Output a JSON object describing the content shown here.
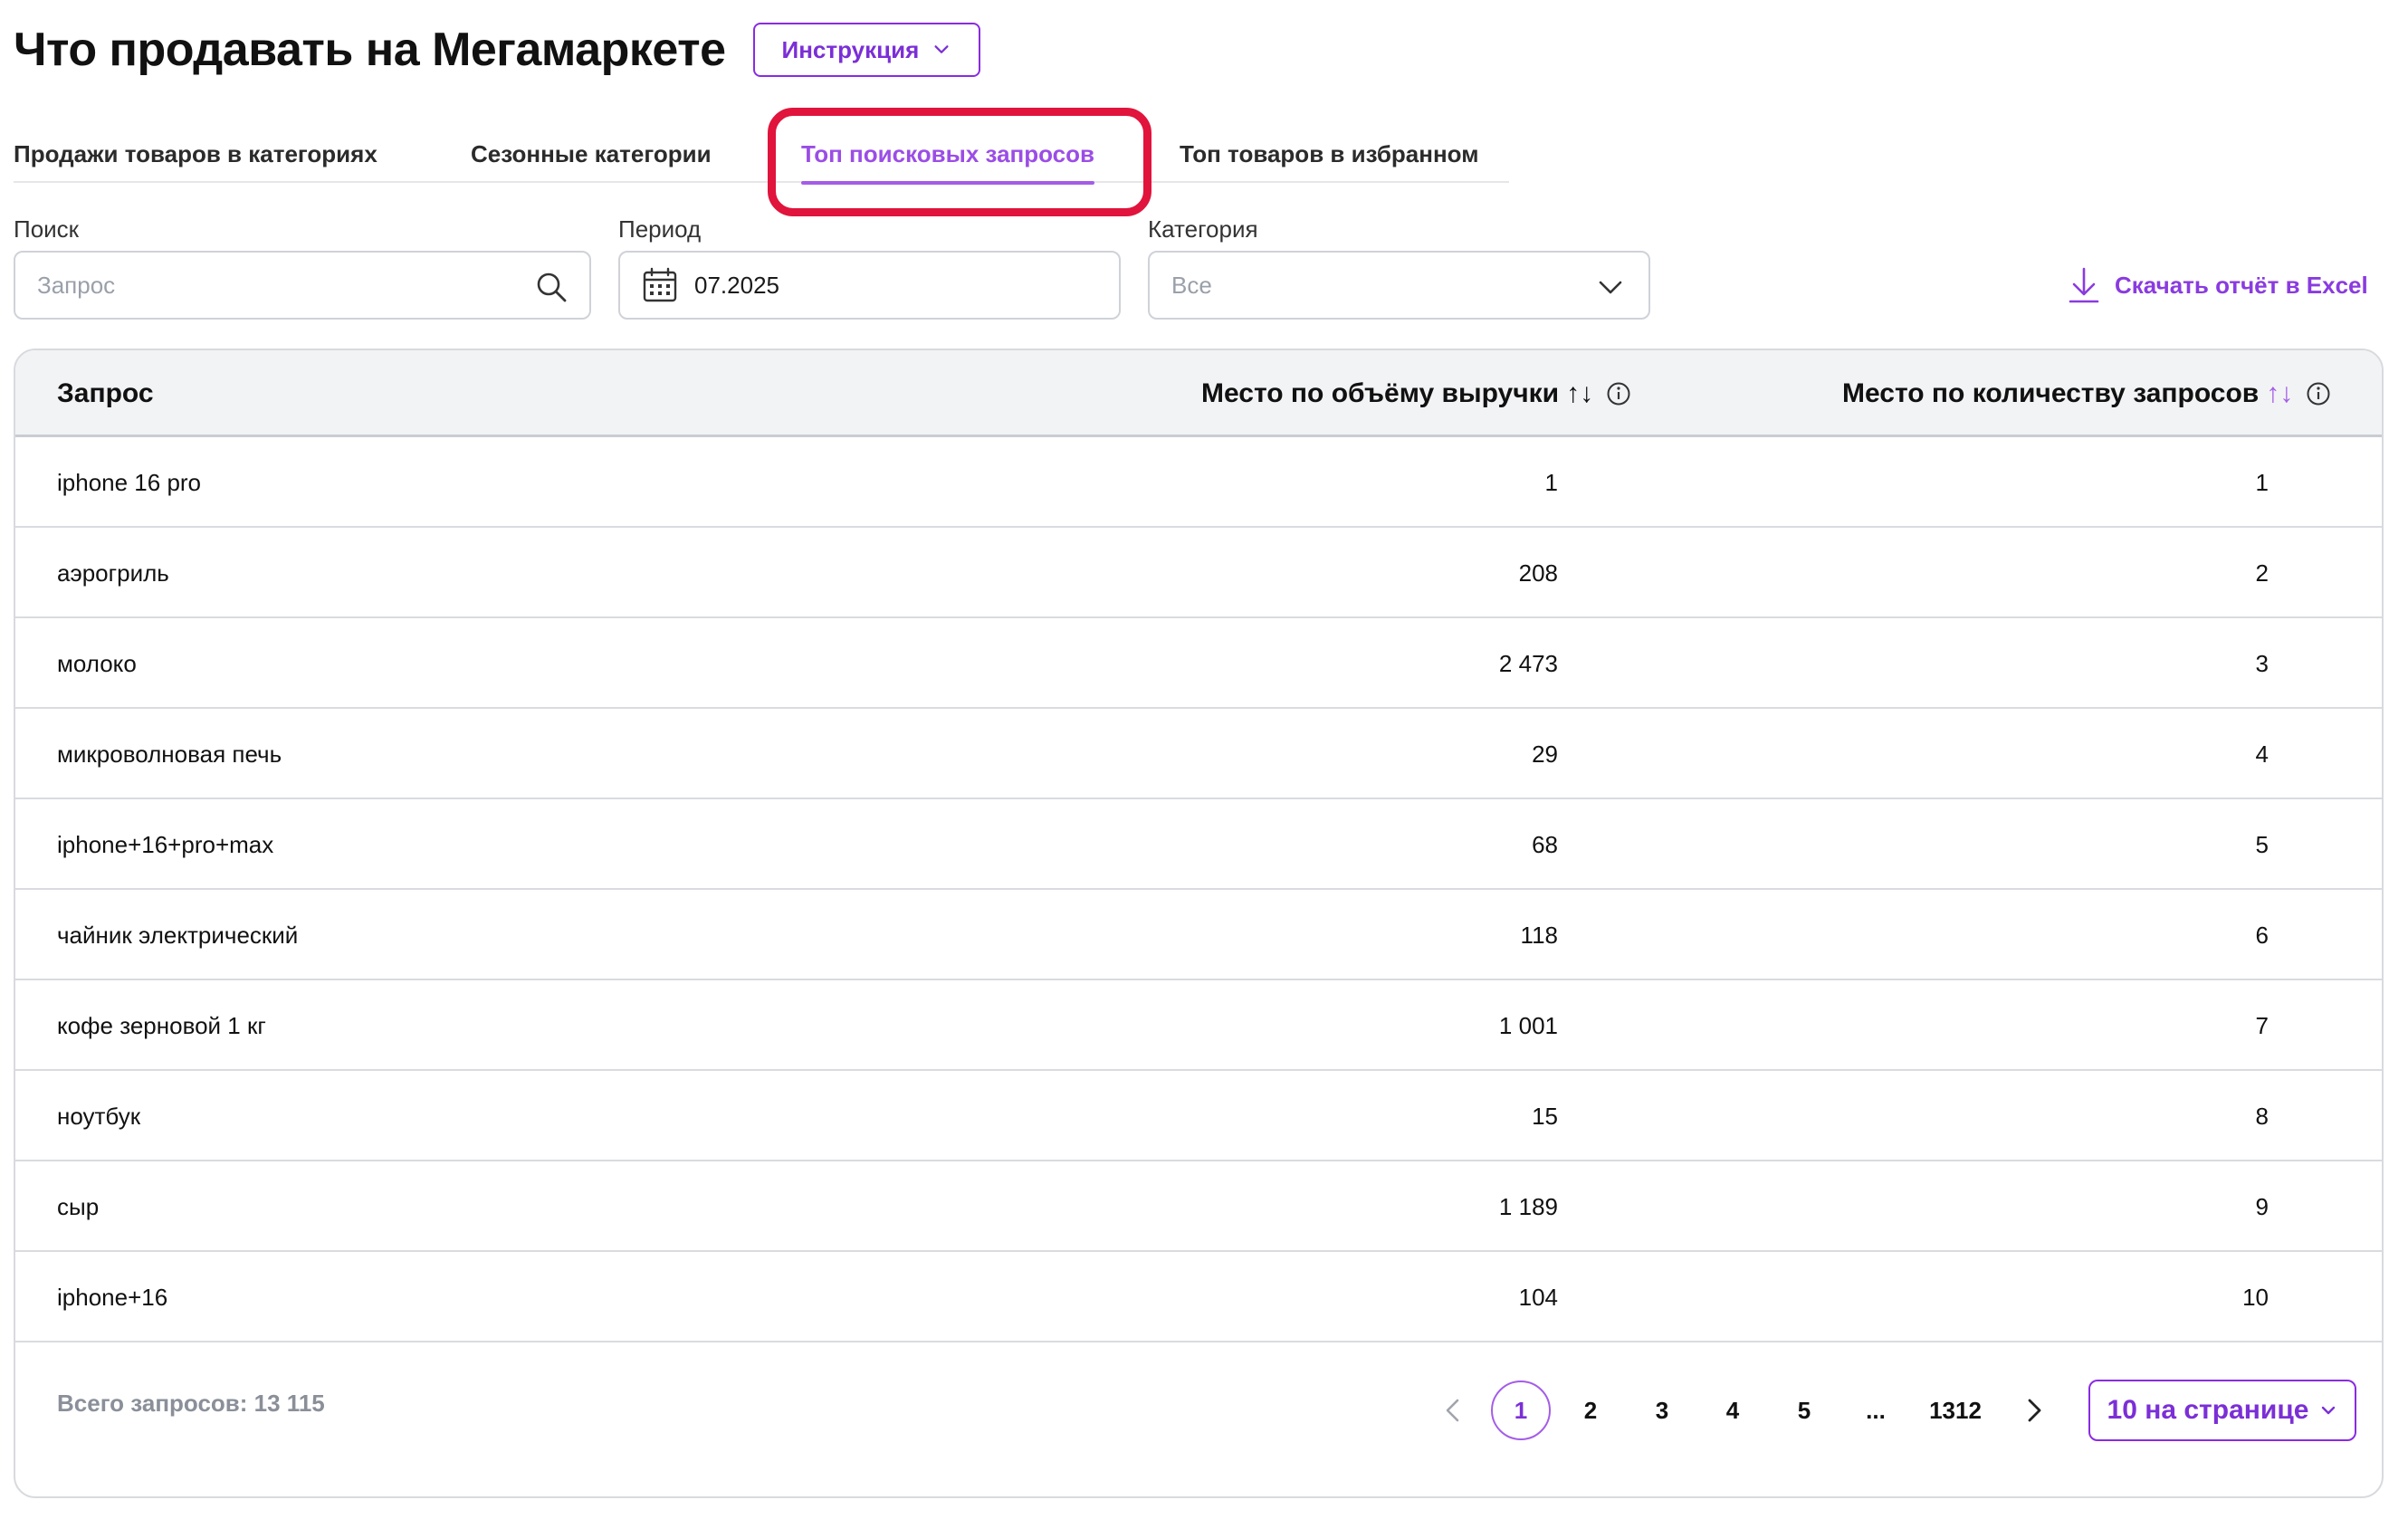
{
  "header": {
    "title": "Что продавать на Мегамаркете",
    "instruction_label": "Инструкция"
  },
  "tabs": [
    {
      "label": "Продажи товаров в категориях",
      "active": false
    },
    {
      "label": "Сезонные категории",
      "active": false
    },
    {
      "label": "Топ поисковых запросов",
      "active": true
    },
    {
      "label": "Топ товаров в избранном",
      "active": false
    }
  ],
  "filters": {
    "search_label": "Поиск",
    "search_placeholder": "Запрос",
    "search_value": "",
    "period_label": "Период",
    "period_value": "07.2025",
    "category_label": "Категория",
    "category_value": "Все"
  },
  "download_label": "Скачать отчёт в Excel",
  "table": {
    "columns": [
      "Запрос",
      "Место по объёму выручки",
      "Место по количеству запросов"
    ],
    "rows": [
      [
        "iphone 16 pro",
        "1",
        "1"
      ],
      [
        "аэрогриль",
        "208",
        "2"
      ],
      [
        "молоко",
        "2 473",
        "3"
      ],
      [
        "микроволновая печь",
        "29",
        "4"
      ],
      [
        "iphone+16+pro+max",
        "68",
        "5"
      ],
      [
        "чайник электрический",
        "118",
        "6"
      ],
      [
        "кофе зерновой 1 кг",
        "1 001",
        "7"
      ],
      [
        "ноутбук",
        "15",
        "8"
      ],
      [
        "сыр",
        "1 189",
        "9"
      ],
      [
        "iphone+16",
        "104",
        "10"
      ]
    ]
  },
  "footer": {
    "total_label": "Всего запросов: 13 115",
    "pages": [
      "1",
      "2",
      "3",
      "4",
      "5",
      "...",
      "1312"
    ],
    "current_page": "1",
    "per_page_label": "10 на странице"
  },
  "colors": {
    "accent": "#8a2be2",
    "accent_light": "#a45de8",
    "highlight": "#e0143c",
    "header_bg": "#f2f3f5"
  }
}
